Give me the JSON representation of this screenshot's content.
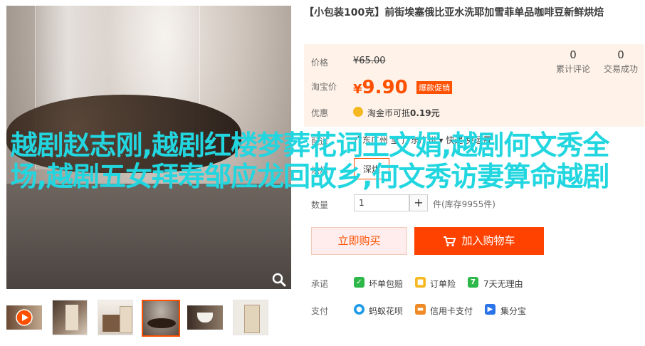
{
  "product": {
    "title": "【小包装100克】前街埃塞俄比亚水洗耶加雪菲单品咖啡豆新鲜烘焙"
  },
  "price": {
    "label_original": "价格",
    "original_value": "¥65.00",
    "label_taobao": "淘宝价",
    "currency": "¥",
    "current_value": "9.90",
    "promo_tag": "爆款促销",
    "stats": [
      {
        "value": "0",
        "label": "累计评论"
      },
      {
        "value": "0",
        "label": "交易成功"
      }
    ],
    "label_discount": "优惠",
    "coin_text_prefix": "淘金币可抵",
    "coin_amount": "0.19元"
  },
  "options": {
    "shipping_label": "配送",
    "shipping_text": "广东广州 至 广东广州 ▾ 快递 免运费",
    "spec_label": "烘焙",
    "spec_value": "深烘",
    "qty_label": "数量",
    "qty_value": "1",
    "plus_label": "+",
    "stock_text": "件(库存9955件)"
  },
  "actions": {
    "buy_now": "立即购买",
    "add_to_cart": "加入购物车"
  },
  "services": {
    "promise_label": "承诺",
    "promise_items": [
      {
        "icon": "shield-icon",
        "text": "坏单包赔",
        "color": "#2fb84a"
      },
      {
        "icon": "lock-icon",
        "text": "订单险",
        "color": "#f5b820"
      },
      {
        "icon": "seven-day-icon",
        "text": "7天无理由",
        "color": "#2fb84a"
      }
    ],
    "pay_label": "支付",
    "pay_items": [
      {
        "icon": "huabei-icon",
        "text": "蚂蚁花呗",
        "color": "#1f9be8"
      },
      {
        "icon": "credit-card-icon",
        "text": "信用卡支付",
        "color": "#f08a24"
      },
      {
        "icon": "jifenbao-icon",
        "text": "集分宝",
        "color": "#2a73e8"
      }
    ]
  },
  "overlay_text": "越剧赵志刚,越剧红楼梦葬花词王文娟,越剧何文秀全场,越剧五女拜寿邹应龙回故乡,何文秀访妻算命越剧",
  "colors": {
    "accent": "#ff5000",
    "overlay": "#22d6e0"
  }
}
